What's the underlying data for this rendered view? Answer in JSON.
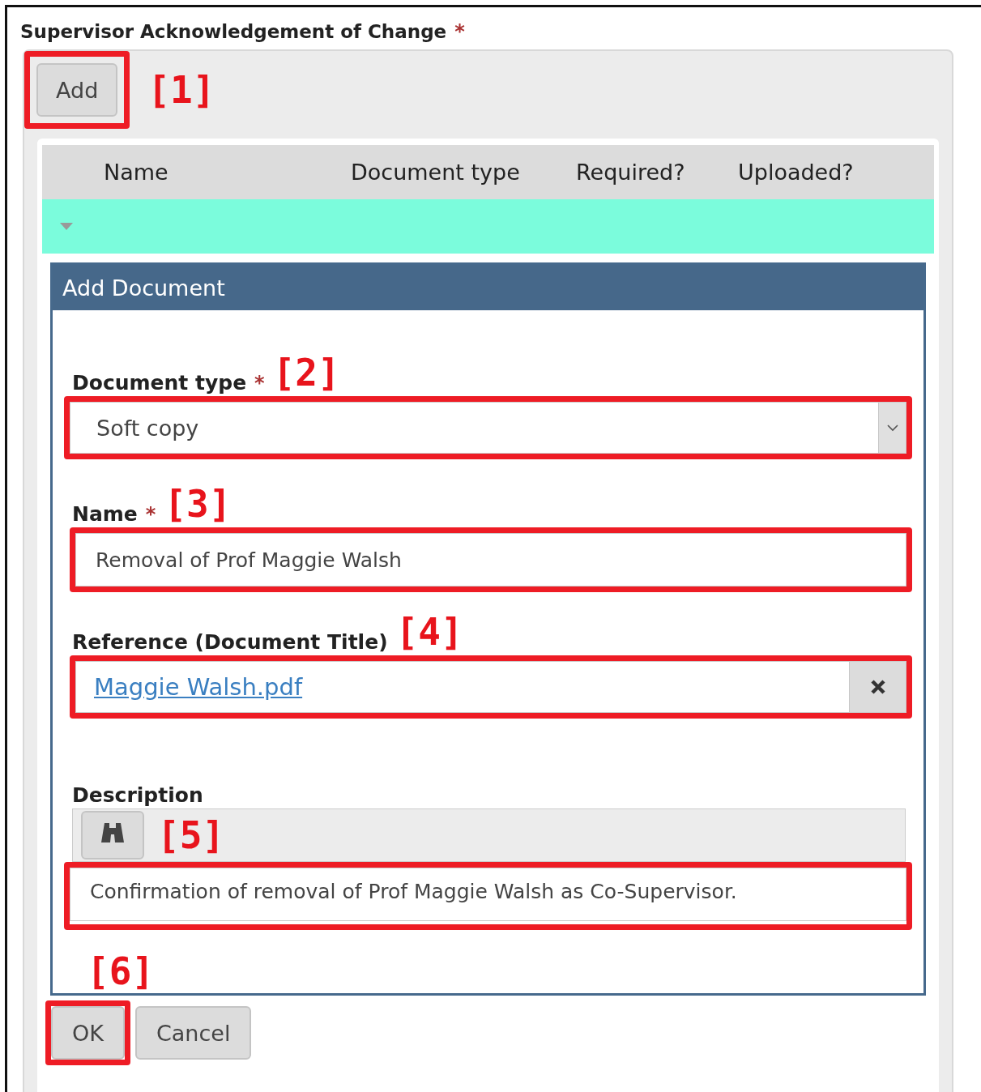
{
  "section": {
    "title": "Supervisor Acknowledgement of Change",
    "required_mark": "*"
  },
  "add_button": {
    "label": "Add",
    "highlighted": true,
    "callout": "[1]"
  },
  "table": {
    "columns": [
      "Name",
      "Document type",
      "Required?",
      "Uploaded?"
    ],
    "rows": [
      {
        "expanded": true,
        "selected": true
      }
    ]
  },
  "dialog": {
    "title": "Add Document",
    "fields": [
      {
        "kind": "select",
        "label": "Document type",
        "required_mark": "*",
        "callout": "[2]",
        "highlighted": true,
        "value": "Soft copy"
      },
      {
        "kind": "text",
        "label": "Name",
        "required_mark": "*",
        "callout": "[3]",
        "highlighted": true,
        "value": "Removal of Prof Maggie Walsh"
      },
      {
        "kind": "file",
        "label": "Reference (Document Title)",
        "callout": "[4]",
        "highlighted": true,
        "value": "Maggie Walsh.pdf"
      },
      {
        "kind": "textarea",
        "label": "Description",
        "callout": "[5]",
        "highlighted": true,
        "value": "Confirmation of removal of Prof Maggie Walsh as Co-Supervisor."
      }
    ],
    "callout": "[6]",
    "buttons": [
      {
        "label": "OK",
        "highlighted": true
      },
      {
        "label": "Cancel",
        "highlighted": false
      }
    ]
  }
}
